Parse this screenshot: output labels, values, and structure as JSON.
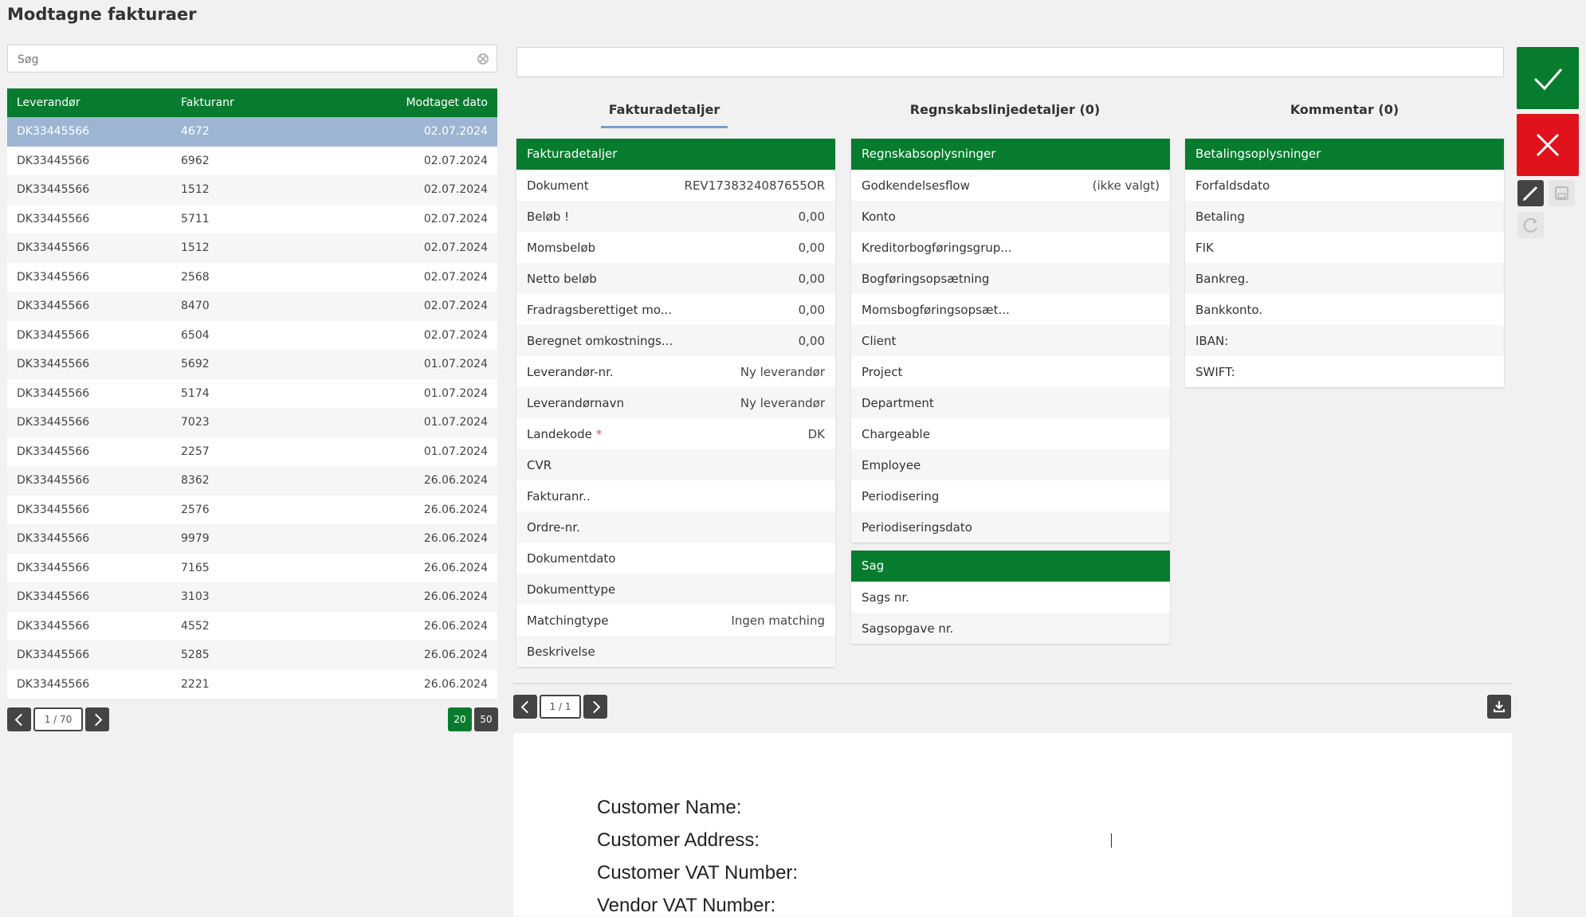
{
  "page": {
    "title": "Modtagne fakturaer"
  },
  "search": {
    "placeholder": "Søg"
  },
  "invoice_table": {
    "headers": {
      "supplier": "Leverandør",
      "invoice_no": "Fakturanr",
      "received": "Modtaget dato"
    },
    "rows": [
      {
        "supplier": "DK33445566",
        "invoice_no": "4672",
        "received": "02.07.2024",
        "selected": true
      },
      {
        "supplier": "DK33445566",
        "invoice_no": "6962",
        "received": "02.07.2024"
      },
      {
        "supplier": "DK33445566",
        "invoice_no": "1512",
        "received": "02.07.2024"
      },
      {
        "supplier": "DK33445566",
        "invoice_no": "5711",
        "received": "02.07.2024"
      },
      {
        "supplier": "DK33445566",
        "invoice_no": "1512",
        "received": "02.07.2024"
      },
      {
        "supplier": "DK33445566",
        "invoice_no": "2568",
        "received": "02.07.2024"
      },
      {
        "supplier": "DK33445566",
        "invoice_no": "8470",
        "received": "02.07.2024"
      },
      {
        "supplier": "DK33445566",
        "invoice_no": "6504",
        "received": "02.07.2024"
      },
      {
        "supplier": "DK33445566",
        "invoice_no": "5692",
        "received": "01.07.2024"
      },
      {
        "supplier": "DK33445566",
        "invoice_no": "5174",
        "received": "01.07.2024"
      },
      {
        "supplier": "DK33445566",
        "invoice_no": "7023",
        "received": "01.07.2024"
      },
      {
        "supplier": "DK33445566",
        "invoice_no": "2257",
        "received": "01.07.2024"
      },
      {
        "supplier": "DK33445566",
        "invoice_no": "8362",
        "received": "26.06.2024"
      },
      {
        "supplier": "DK33445566",
        "invoice_no": "2576",
        "received": "26.06.2024"
      },
      {
        "supplier": "DK33445566",
        "invoice_no": "9979",
        "received": "26.06.2024"
      },
      {
        "supplier": "DK33445566",
        "invoice_no": "7165",
        "received": "26.06.2024"
      },
      {
        "supplier": "DK33445566",
        "invoice_no": "3103",
        "received": "26.06.2024"
      },
      {
        "supplier": "DK33445566",
        "invoice_no": "4552",
        "received": "26.06.2024"
      },
      {
        "supplier": "DK33445566",
        "invoice_no": "5285",
        "received": "26.06.2024"
      },
      {
        "supplier": "DK33445566",
        "invoice_no": "2221",
        "received": "26.06.2024"
      }
    ],
    "pager": {
      "text": "1 / 70"
    },
    "page_sizes": {
      "small": "20",
      "large": "50",
      "active": "20"
    }
  },
  "tabs": [
    {
      "label": "Fakturadetaljer",
      "active": true
    },
    {
      "label": "Regnskabslinjedetaljer (0)"
    },
    {
      "label": "Kommentar (0)"
    }
  ],
  "invoice_details": {
    "title": "Fakturadetaljer",
    "fields": [
      {
        "label": "Dokument",
        "value": "REV1738324087655OR"
      },
      {
        "label": "Beløb !",
        "value": "0,00"
      },
      {
        "label": "Momsbeløb",
        "value": "0,00"
      },
      {
        "label": "Netto beløb",
        "value": "0,00"
      },
      {
        "label": "Fradragsberettiget mo...",
        "value": "0,00"
      },
      {
        "label": "Beregnet omkostnings...",
        "value": "0,00"
      },
      {
        "label": "Leverandør-nr.",
        "value": "Ny leverandør"
      },
      {
        "label": "Leverandørnavn",
        "value": "Ny leverandør"
      },
      {
        "label": "Landekode",
        "value": "DK",
        "required_mark": "*"
      },
      {
        "label": "CVR",
        "value": ""
      },
      {
        "label": "Fakturanr..",
        "value": ""
      },
      {
        "label": "Ordre-nr.",
        "value": ""
      },
      {
        "label": "Dokumentdato",
        "value": ""
      },
      {
        "label": "Dokumenttype",
        "value": ""
      },
      {
        "label": "Matchingtype",
        "value": "Ingen matching"
      },
      {
        "label": "Beskrivelse",
        "value": ""
      }
    ]
  },
  "accounting": {
    "title": "Regnskabsoplysninger",
    "fields": [
      {
        "label": "Godkendelsesflow",
        "value": "(ikke valgt)"
      },
      {
        "label": "Konto",
        "value": ""
      },
      {
        "label": "Kreditorbogføringsgrup...",
        "value": ""
      },
      {
        "label": "Bogføringsopsætning",
        "value": ""
      },
      {
        "label": "Momsbogføringsopsæt...",
        "value": ""
      },
      {
        "label": "Client",
        "value": ""
      },
      {
        "label": "Project",
        "value": ""
      },
      {
        "label": "Department",
        "value": ""
      },
      {
        "label": "Chargeable",
        "value": ""
      },
      {
        "label": "Employee",
        "value": ""
      },
      {
        "label": "Periodisering",
        "value": ""
      },
      {
        "label": "Periodiseringsdato",
        "value": ""
      }
    ]
  },
  "case": {
    "title": "Sag",
    "fields": [
      {
        "label": "Sags nr.",
        "value": ""
      },
      {
        "label": "Sagsopgave nr.",
        "value": ""
      }
    ]
  },
  "payment": {
    "title": "Betalingsoplysninger",
    "fields": [
      {
        "label": "Forfaldsdato",
        "value": ""
      },
      {
        "label": "Betaling",
        "value": ""
      },
      {
        "label": "FIK",
        "value": ""
      },
      {
        "label": "Bankreg.",
        "value": ""
      },
      {
        "label": "Bankkonto.",
        "value": ""
      },
      {
        "label": "IBAN:",
        "value": ""
      },
      {
        "label": "SWIFT:",
        "value": ""
      }
    ]
  },
  "actions": {
    "approve_icon": "check-icon",
    "reject_icon": "close-icon",
    "edit_icon": "pencil-icon",
    "save_icon": "save-icon",
    "refresh_icon": "refresh-icon"
  },
  "document_viewer": {
    "pager": {
      "text": "1 / 1"
    },
    "download_icon": "download-icon",
    "lines": [
      "Customer Name:",
      "Customer Address:",
      "Customer VAT Number:",
      "Vendor VAT Number:"
    ]
  },
  "colors": {
    "brand_green": "#077c2f",
    "reject_red": "#e0131d",
    "selected_row": "#9db5d3",
    "dark_button": "#444444"
  }
}
